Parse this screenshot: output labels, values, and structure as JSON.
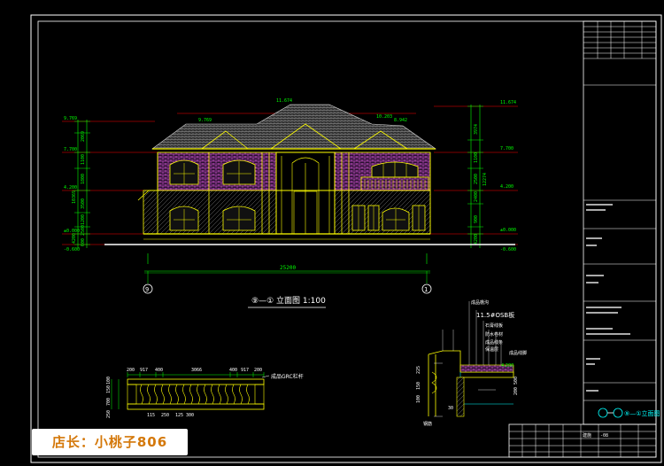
{
  "drawing": {
    "main_caption": "⑨—① 立面图 1:100",
    "axis_left": "9",
    "axis_right": "1",
    "overall_dim": "25200",
    "left_elev": {
      "levels": [
        "9.769",
        "7.700",
        "4.200",
        "±0.000",
        "-0.600"
      ],
      "dims": [
        "2069",
        "1100",
        "1800",
        "3500",
        "1200",
        "2500",
        "4200",
        "600",
        "10369"
      ]
    },
    "right_elev": {
      "levels": [
        "11.674",
        "7.700",
        "4.200",
        "±0.000",
        "-0.600"
      ],
      "dims": [
        "3974",
        "1100",
        "2500",
        "2400",
        "900",
        "4200",
        "300",
        "12274"
      ]
    },
    "roof_levels": [
      "11.674",
      "9.769",
      "10.203",
      "8.942"
    ],
    "baluster_dims_top": [
      "200",
      "917",
      "400",
      "3066",
      "400",
      "917",
      "200"
    ],
    "baluster_dims_bottom": [
      "115",
      "250",
      "125",
      "300"
    ],
    "baluster_note": "成品GRC栏杆",
    "baluster_side_dims": [
      "100",
      "150",
      "700",
      "250"
    ],
    "section": {
      "labels": [
        "成品檐沟",
        "11.5#OSB板",
        "石膏线板",
        "防水卷材",
        "成品线条",
        "保温层",
        "成品线脚",
        "4.200"
      ],
      "dims": [
        "225",
        "150",
        "100",
        "500",
        "200",
        "30"
      ],
      "bottom_label": "钢筋"
    },
    "titleblock": {
      "sheet_title": "⑨—①立面图",
      "rows": [
        "建施",
        "-08"
      ]
    }
  },
  "watermark": {
    "text": "店长：小桃子",
    "num": "806"
  },
  "colors": {
    "frame": "#ffffff",
    "building": "#ffff00",
    "roof": "#c8c8c8",
    "dim": "#00ff00",
    "level_line": "#ff0000",
    "brick": "#ff66ff",
    "cyan": "#00ffff",
    "watermark": "#d4780a"
  }
}
